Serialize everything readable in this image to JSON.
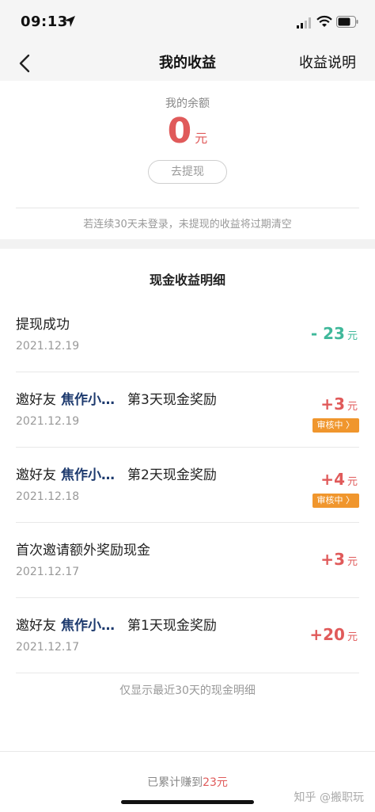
{
  "status_bar": {
    "time": "09:13"
  },
  "nav": {
    "title": "我的收益",
    "right_link": "收益说明"
  },
  "balance": {
    "label": "我的余额",
    "amount": "0",
    "unit": "元",
    "withdraw_button": "去提现"
  },
  "notice": "若连续30天未登录，未提现的收益将过期清空",
  "section_title": "现金收益明细",
  "records": [
    {
      "prefix": "提现成功",
      "friend": "",
      "suffix": "",
      "date": "2021.12.19",
      "sign": "-",
      "amount": "23",
      "unit": "元",
      "badge": "",
      "type": "negative"
    },
    {
      "prefix": "邀好友",
      "friend": "焦作小…",
      "suffix": "第3天现金奖励",
      "date": "2021.12.19",
      "sign": "+",
      "amount": "3",
      "unit": "元",
      "badge": "审核中 〉",
      "type": "positive"
    },
    {
      "prefix": "邀好友",
      "friend": "焦作小…",
      "suffix": "第2天现金奖励",
      "date": "2021.12.18",
      "sign": "+",
      "amount": "4",
      "unit": "元",
      "badge": "审核中 〉",
      "type": "positive"
    },
    {
      "prefix": "首次邀请额外奖励现金",
      "friend": "",
      "suffix": "",
      "date": "2021.12.17",
      "sign": "+",
      "amount": "3",
      "unit": "元",
      "badge": "",
      "type": "positive"
    },
    {
      "prefix": "邀好友",
      "friend": "焦作小…",
      "suffix": "第1天现金奖励",
      "date": "2021.12.17",
      "sign": "+",
      "amount": "20",
      "unit": "元",
      "badge": "",
      "type": "positive"
    }
  ],
  "footer_note": "仅显示最近30天的现金明细",
  "total": {
    "prefix": "已累计赚到",
    "amount": "23元"
  },
  "watermark": "知乎 @搬职玩",
  "colors": {
    "accent_red": "#e05a5a",
    "negative_green": "#3fb89a",
    "badge_orange": "#f0962d",
    "friend_blue": "#1d3a6e"
  }
}
